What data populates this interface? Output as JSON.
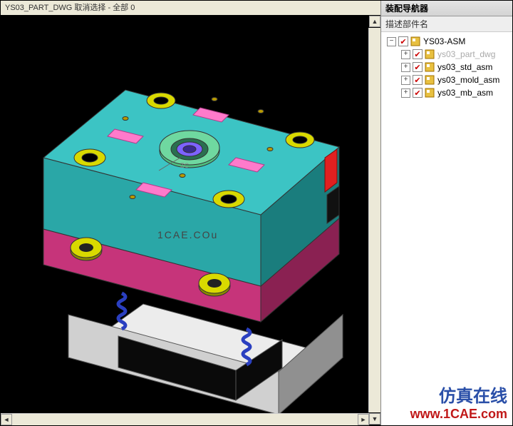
{
  "window": {
    "title": "YS03_PART_DWG   取消选择 - 全部 0"
  },
  "sidebar": {
    "panel_title": "装配导航器",
    "header_label": "描述部件名",
    "tree": {
      "root": {
        "expander": "−",
        "checked": true,
        "label": "YS03-ASM"
      },
      "children": [
        {
          "expander": "+",
          "checked": true,
          "label": "ys03_part_dwg",
          "dim": true
        },
        {
          "expander": "+",
          "checked": true,
          "label": "ys03_std_asm",
          "dim": false
        },
        {
          "expander": "+",
          "checked": true,
          "label": "ys03_mold_asm",
          "dim": false
        },
        {
          "expander": "+",
          "checked": true,
          "label": "ys03_mb_asm",
          "dim": false
        }
      ]
    }
  },
  "viewport": {
    "axis_label": "ZC",
    "center_watermark": "1CAE.COu"
  },
  "watermark": {
    "cn": "仿真在线",
    "url": "www.1CAE.com"
  },
  "colors": {
    "top_plate": "#3cc4c4",
    "mid_plate": "#c6347a",
    "base_plate": "#e8e8e8",
    "spring": "#2a3fc0",
    "pink_tab": "#ff7acb",
    "ring_green": "#4fbf80",
    "bolt_gold": "#b89a00",
    "red_clip": "#e02020"
  }
}
